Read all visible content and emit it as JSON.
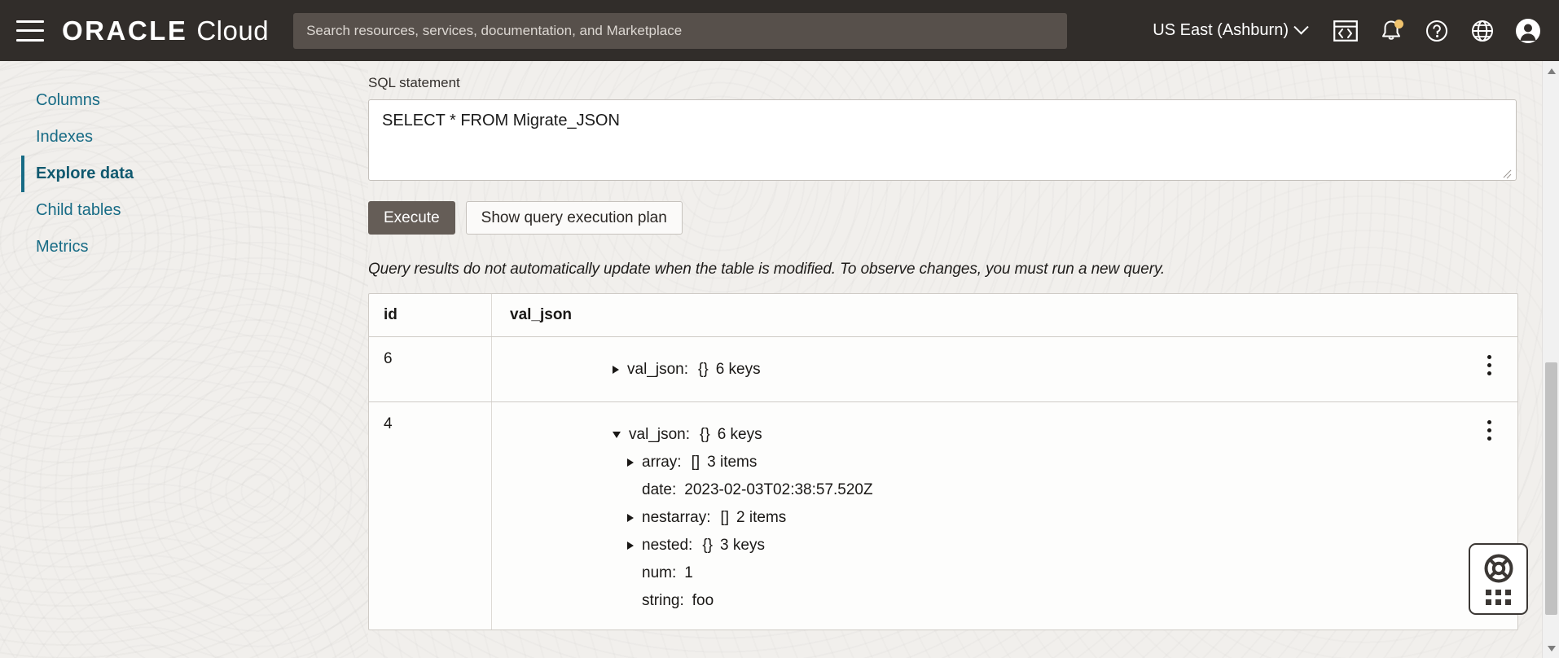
{
  "header": {
    "menu_icon": "hamburger-menu-icon",
    "brand_oracle": "ORACLE",
    "brand_cloud": "Cloud",
    "search_placeholder": "Search resources, services, documentation, and Marketplace",
    "search_value": "",
    "region": "US East (Ashburn)",
    "icons": [
      {
        "name": "cloud-shell-icon",
        "label": "Cloud Shell"
      },
      {
        "name": "notifications-bell-icon",
        "label": "Notifications",
        "badge": true
      },
      {
        "name": "help-question-icon",
        "label": "Help"
      },
      {
        "name": "language-globe-icon",
        "label": "Language"
      },
      {
        "name": "user-profile-icon",
        "label": "Profile"
      }
    ],
    "bg_color": "#312d2a",
    "search_bg": "#57504b"
  },
  "sidebar": {
    "items": [
      {
        "label": "Columns",
        "active": false
      },
      {
        "label": "Indexes",
        "active": false
      },
      {
        "label": "Explore data",
        "active": true
      },
      {
        "label": "Child tables",
        "active": false
      },
      {
        "label": "Metrics",
        "active": false
      }
    ],
    "link_color": "#176b85"
  },
  "main": {
    "sql_label": "SQL statement",
    "sql_value": "SELECT * FROM Migrate_JSON",
    "sql_placeholder": "Enter a SQL statement",
    "execute_label": "Execute",
    "show_plan_label": "Show query execution plan",
    "notice": "Query results do not automatically update when the table is modified. To observe changes, you must run a new query.",
    "primary_button_color": "#655d57"
  },
  "results": {
    "columns": [
      "id",
      "val_json"
    ],
    "rows": [
      {
        "id": "6",
        "expanded": false,
        "tree": [
          {
            "indent": 0,
            "toggle": "right",
            "key": "val_json:",
            "type": "{}",
            "count": "6 keys",
            "value": ""
          }
        ]
      },
      {
        "id": "4",
        "expanded": true,
        "tree": [
          {
            "indent": 0,
            "toggle": "down",
            "key": "val_json:",
            "type": "{}",
            "count": "6 keys",
            "value": ""
          },
          {
            "indent": 1,
            "toggle": "right",
            "key": "array:",
            "type": "[]",
            "count": "3 items",
            "value": ""
          },
          {
            "indent": 1,
            "toggle": "none",
            "key": "date:",
            "type": "",
            "count": "",
            "value": "2023-02-03T02:38:57.520Z"
          },
          {
            "indent": 1,
            "toggle": "right",
            "key": "nestarray:",
            "type": "[]",
            "count": "2 items",
            "value": ""
          },
          {
            "indent": 1,
            "toggle": "right",
            "key": "nested:",
            "type": "{}",
            "count": "3 keys",
            "value": ""
          },
          {
            "indent": 1,
            "toggle": "none",
            "key": "num:",
            "type": "",
            "count": "",
            "value": "1"
          },
          {
            "indent": 1,
            "toggle": "none",
            "key": "string:",
            "type": "",
            "count": "",
            "value": "foo"
          }
        ]
      }
    ],
    "row_menu_icon": "kebab-menu-icon"
  },
  "help_widget": {
    "icon": "lifebuoy-support-icon",
    "grid_icon": "dot-grid-icon"
  }
}
